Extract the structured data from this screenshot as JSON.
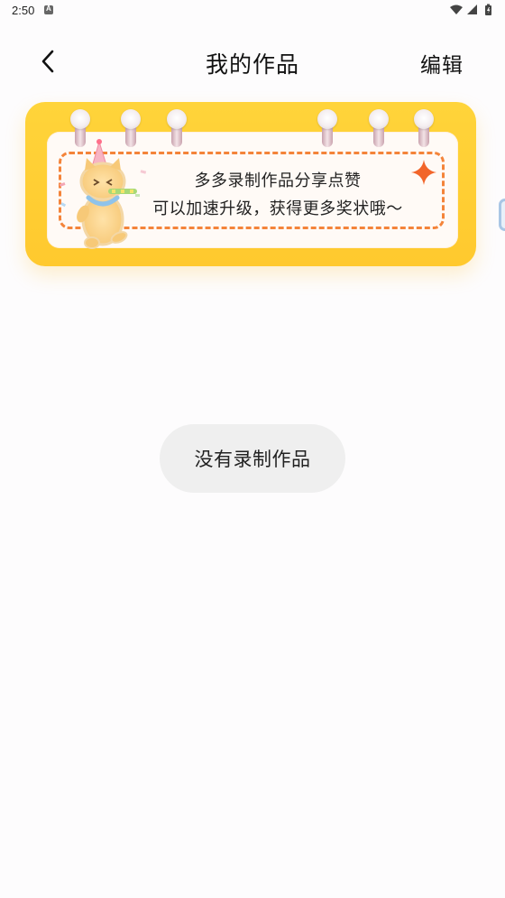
{
  "status_bar": {
    "time": "2:50",
    "icons": [
      "notification-icon",
      "wifi-icon",
      "signal-icon",
      "battery-icon"
    ]
  },
  "header": {
    "back_icon": "chevron-left-icon",
    "title": "我的作品",
    "edit_label": "编辑"
  },
  "banner": {
    "line1": "多多录制作品分享点赞",
    "line2": "可以加速升级，获得更多奖状哦～",
    "colors": {
      "frame": "#ffc92e",
      "paper": "#fffaf6",
      "dash": "#f4843a",
      "sparkle": "#f2652a"
    },
    "decorations": [
      "binder-ring-icon",
      "mascot-cat-illustration",
      "sparkle-icon"
    ]
  },
  "empty_state": {
    "message": "没有录制作品"
  }
}
